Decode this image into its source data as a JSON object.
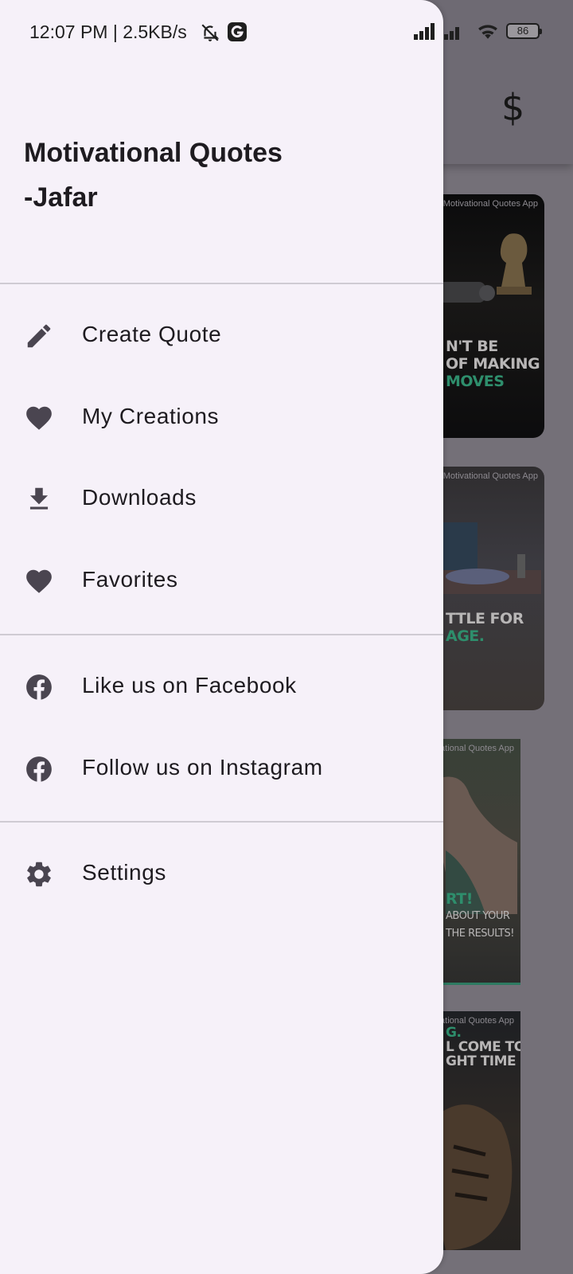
{
  "status_bar": {
    "time_text": "12:07 PM | 2.5KB/s",
    "battery_level": "86",
    "icons": [
      "bell-off-icon",
      "g-app-icon",
      "signal-icon",
      "signal-icon",
      "wifi-icon",
      "battery-icon"
    ]
  },
  "background_app": {
    "appbar_icon": "dollar-icon",
    "dollar_symbol": "$",
    "cards": [
      {
        "watermark": "Motivational Quotes App",
        "lines": [
          "N'T BE",
          "OF MAKING",
          "MOVES"
        ]
      },
      {
        "watermark": "Motivational Quotes App",
        "lines": [
          "TTLE FOR",
          "AGE."
        ]
      },
      {
        "watermark": "Motivational Quotes App",
        "lines": [
          "RT!",
          "ABOUT YOUR",
          "THE RESULTS!"
        ]
      },
      {
        "watermark": "Motivational Quotes App",
        "lines": [
          "G.",
          "L COME TO",
          "GHT TIME"
        ]
      }
    ]
  },
  "drawer": {
    "title_line1": "Motivational Quotes",
    "title_line2": "-Jafar",
    "sections": [
      {
        "items": [
          {
            "label": "Create Quote",
            "icon": "pencil-icon"
          },
          {
            "label": "My Creations",
            "icon": "heart-icon"
          },
          {
            "label": "Downloads",
            "icon": "download-icon"
          },
          {
            "label": "Favorites",
            "icon": "heart-icon"
          }
        ]
      },
      {
        "items": [
          {
            "label": "Like us on Facebook",
            "icon": "facebook-icon"
          },
          {
            "label": "Follow us on Instagram",
            "icon": "facebook-icon"
          }
        ]
      },
      {
        "items": [
          {
            "label": "Settings",
            "icon": "gear-icon"
          }
        ]
      }
    ]
  },
  "colors": {
    "drawer_bg": "#f6f1f9",
    "icon": "#4a4550",
    "text": "#1e1b20",
    "scrim": "#747078",
    "accent_green": "#2e8e6c"
  }
}
